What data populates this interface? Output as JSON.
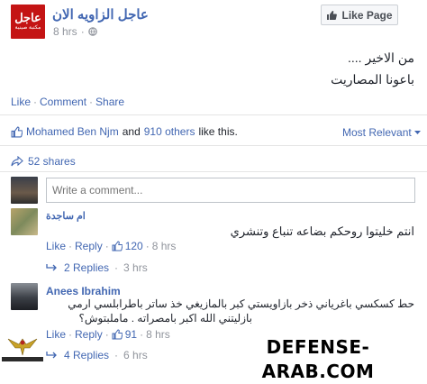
{
  "page": {
    "name": "عاجل الزاويه الان",
    "logo_text": "عاجل",
    "logo_subtext": "مكتبة صينية",
    "time": "8 hrs",
    "like_page_label": "Like Page"
  },
  "post": {
    "line1": "من الاخير ....",
    "line2": "باعونا المصاريت"
  },
  "actions": {
    "like": "Like",
    "comment": "Comment",
    "share": "Share",
    "sep": "·"
  },
  "likes_bar": {
    "name": "Mohamed Ben Njm",
    "and": "and",
    "others": "910 others",
    "suffix": "like this.",
    "sort": "Most Relevant"
  },
  "shares": "52 shares",
  "comment_input": {
    "placeholder": "Write a comment..."
  },
  "comments": [
    {
      "author": "ام ساجدة",
      "text": "انتم خليتوا روحكم بضاعه تنباع وتنشري",
      "like": "Like",
      "reply": "Reply",
      "likes": "120",
      "time": "8 hrs",
      "replies": "2 Replies",
      "replies_time": "3 hrs"
    },
    {
      "author": "Anees Ibrahim",
      "text_line1": "حط كسكسي باغرياني ذخر بازاويستي كبر بالمازيغي خذ ساتر باطرابلسي ارمي",
      "text_line2": "بازليتني الله اكبر بامصراته . ماملبتوش؟",
      "like": "Like",
      "reply": "Reply",
      "likes": "91",
      "time": "8 hrs",
      "replies": "4 Replies",
      "replies_time": "6 hrs"
    }
  ],
  "watermark": "DEFENSE-ARAB.COM",
  "watermark_logo": "ARAB DEFENSE FORUM",
  "colors": {
    "link": "#4267b2",
    "muted": "#90949c",
    "logo_red": "#c41414"
  }
}
